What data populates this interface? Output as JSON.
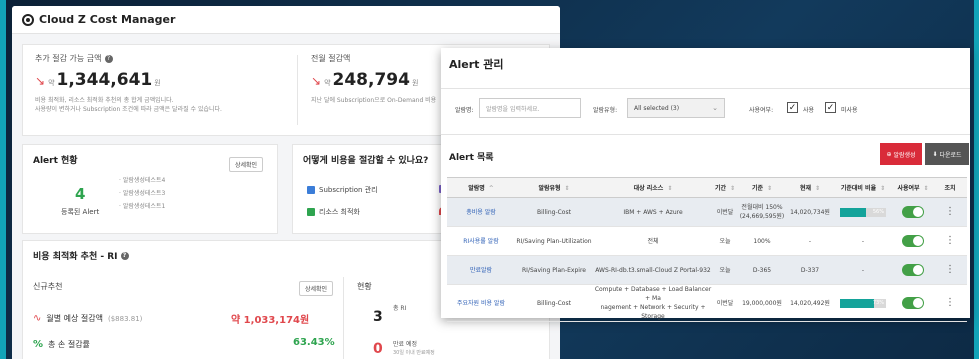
{
  "app": {
    "title": "Cloud Z Cost Manager"
  },
  "savings": {
    "additional": {
      "label": "추가 절감 가능 금액",
      "approx": "약",
      "value": "1,344,641",
      "unit": "원",
      "note_line1": "비용 최적화, 리소스 최적화 추천의 총 합계 금액입니다.",
      "note_line2": "사용량이 변하거나 Subscription 조건에 따라 금액은 달라질 수 있습니다."
    },
    "prev_month": {
      "label": "전월 절감액",
      "approx": "약",
      "value": "248,794",
      "unit": "원",
      "note_line1": "지난 달에 Subscription으로 On-Demand 비용"
    }
  },
  "alert_status": {
    "title": "Alert 현황",
    "detail_button": "상세확인",
    "count": "4",
    "count_label": "등록된 Alert",
    "items": [
      "알람생성테스트4",
      "알람생성테스트3",
      "알람생성테스트1"
    ]
  },
  "how_save": {
    "title": "어떻게 비용을 절감할 수 있나요?",
    "subscription": "Subscription 관리",
    "resource": "리소스 최적화",
    "colors": {
      "subscription": "#3b7dd8",
      "resource": "#2ea44f",
      "extra1": "#7b61c9",
      "extra2": "#e0474c"
    }
  },
  "reco": {
    "title": "비용 최적화 추천 - RI",
    "new_label": "신규추천",
    "detail_button": "상세확인",
    "monthly_label": "월별 예상 절감액",
    "monthly_paren": "($883.81)",
    "monthly_value": "약 1,033,174원",
    "total_label": "총 손 절감률",
    "total_value": "63.43%",
    "status_title": "현황",
    "status_num1": "3",
    "status_lbl1": "총 RI",
    "status_num2": "0",
    "status_lbl2": "만료 예정",
    "status_sub2": "30일 이내 만료예정",
    "colors": {
      "monthly": "#e0474c",
      "total": "#2ea44f"
    }
  },
  "alert_mgmt": {
    "title": "Alert 관리",
    "filter_name_label": "알람명:",
    "filter_name_placeholder": "알람명을 입력하세요.",
    "filter_type_label": "알람유형:",
    "filter_type_value": "All selected (3)",
    "filter_use_label": "사용여부:",
    "use_yes": "사용",
    "use_no": "미사용",
    "list_title": "Alert 목록",
    "create_button": "알람생성",
    "download_button": "다운로드",
    "columns": [
      "알람명",
      "알람유형",
      "대상 리소스",
      "기간",
      "기준",
      "현재",
      "기준대비 비율",
      "사용여부",
      "조치"
    ],
    "rows": [
      {
        "name": "총비용 알람",
        "type": "Billing-Cost",
        "resource": "IBM + AWS + Azure",
        "period": "이번달",
        "basis_line1": "전월대비 150%",
        "basis_line2": "(24,669,595원)",
        "current": "14,020,734원",
        "ratio_pct": 57,
        "ratio_text": "56%",
        "enabled": true
      },
      {
        "name": "RI사용률 알람",
        "type": "RI/Saving Plan-Utilization",
        "resource": "전체",
        "period": "오늘",
        "basis_line1": "100%",
        "basis_line2": "",
        "current": "-",
        "ratio_pct": 0,
        "ratio_text": "-",
        "enabled": true
      },
      {
        "name": "만료알람",
        "type": "RI/Saving Plan-Expire",
        "resource": "AWS-RI-db.t3.small-Cloud Z Portal-932",
        "period": "오늘",
        "basis_line1": "D-365",
        "basis_line2": "",
        "current": "D-337",
        "ratio_pct": 0,
        "ratio_text": "-",
        "enabled": true
      },
      {
        "name": "주요자원 비용 알람",
        "type": "Billing-Cost",
        "resource_line1": "Compute + Database + Load Balancer + Ma",
        "resource_line2": "nagement + Network + Security + Storage",
        "period": "이번달",
        "basis_line1": "19,000,000원",
        "basis_line2": "",
        "current": "14,020,492원",
        "ratio_pct": 74,
        "ratio_text": "73%",
        "enabled": true
      }
    ],
    "colors": {
      "create": "#d92b39",
      "download": "#555555",
      "ratio": "#14a39a",
      "toggle": "#43a047"
    }
  }
}
